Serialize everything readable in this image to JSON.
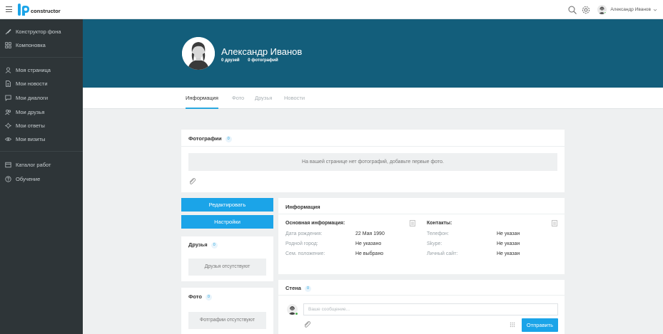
{
  "app": {
    "logo_text": "constructor"
  },
  "topbar": {
    "user_name": "Александр Иванов"
  },
  "sidebar": {
    "items": [
      {
        "label": "Конструктор фона",
        "icon": "brush-icon"
      },
      {
        "label": "Компоновка",
        "icon": "grid-icon"
      },
      {
        "label": "Моя страница",
        "icon": "user-icon"
      },
      {
        "label": "Мои новости",
        "icon": "document-icon"
      },
      {
        "label": "Мои диалоги",
        "icon": "chat-icon"
      },
      {
        "label": "Мои друзья",
        "icon": "users-icon"
      },
      {
        "label": "Мои ответы",
        "icon": "reply-icon"
      },
      {
        "label": "Мои визиты",
        "icon": "eye-icon"
      },
      {
        "label": "Каталог работ",
        "icon": "catalog-icon"
      },
      {
        "label": "Обучение",
        "icon": "help-icon"
      }
    ]
  },
  "profile": {
    "name": "Александр Иванов",
    "friends_count": "0",
    "friends_label": "друзей",
    "photos_count": "0",
    "photos_label": "фотографий"
  },
  "tabs": [
    {
      "label": "Информация",
      "active": true
    },
    {
      "label": "Фото",
      "active": false
    },
    {
      "label": "Друзья",
      "active": false
    },
    {
      "label": "Новости",
      "active": false
    }
  ],
  "photos_card": {
    "title": "Фотографии",
    "count": "0",
    "empty_text": "На вашей странице нет фотографий, добавьте первые фото."
  },
  "buttons": {
    "edit": "Редактировать",
    "settings": "Настройки",
    "send": "Отправить"
  },
  "friends_card": {
    "title": "Друзья",
    "count": "0",
    "empty_text": "Друзья отсутствуют"
  },
  "photo_card": {
    "title": "Фото",
    "count": "0",
    "empty_text": "Фотграфии отсутствуют"
  },
  "info_card": {
    "title": "Информация",
    "basic": {
      "heading": "Основная информация:",
      "rows": [
        {
          "label": "Дата рождения:",
          "value": "22 Мая 1990"
        },
        {
          "label": "Родной город:",
          "value": "Не указано"
        },
        {
          "label": "Сем. положение:",
          "value": "Не выбрано"
        }
      ]
    },
    "contacts": {
      "heading": "Контакты:",
      "rows": [
        {
          "label": "Телефон:",
          "value": "Не указан"
        },
        {
          "label": "Skype:",
          "value": "Не указан"
        },
        {
          "label": "Личный сайт:",
          "value": "Не указан"
        }
      ]
    }
  },
  "wall": {
    "title": "Стена",
    "count": "0",
    "placeholder": "Ваше сообщение..."
  },
  "colors": {
    "accent": "#1ba4e8",
    "cover": "#135e7b",
    "sidebar": "#2e3538",
    "online": "#4caf50"
  }
}
